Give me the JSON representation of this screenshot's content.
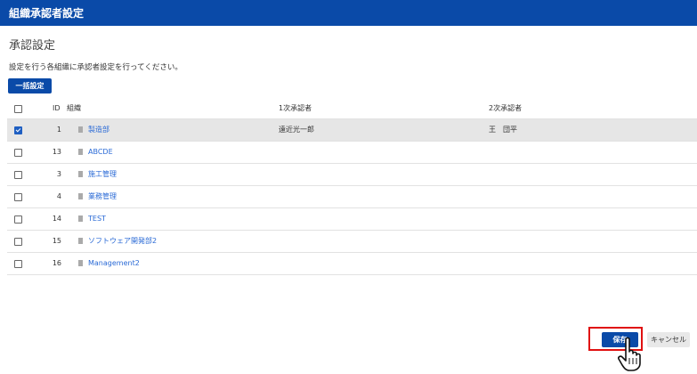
{
  "header": {
    "title": "組織承認者設定"
  },
  "section": {
    "title": "承認設定",
    "description": "設定を行う各組織に承認者設定を行ってください。",
    "bulk_button": "一括設定"
  },
  "table": {
    "columns": {
      "id": "ID",
      "org": "組織",
      "approver1": "1次承認者",
      "approver2": "2次承認者"
    },
    "rows": [
      {
        "id": "1",
        "org": "製造部",
        "approver1": "遠近光一郎",
        "approver2": "王　団平",
        "checked": true
      },
      {
        "id": "13",
        "org": "ABCDE",
        "approver1": "",
        "approver2": "",
        "checked": false
      },
      {
        "id": "3",
        "org": "施工管理",
        "approver1": "",
        "approver2": "",
        "checked": false
      },
      {
        "id": "4",
        "org": "業務管理",
        "approver1": "",
        "approver2": "",
        "checked": false
      },
      {
        "id": "14",
        "org": "TEST",
        "approver1": "",
        "approver2": "",
        "checked": false
      },
      {
        "id": "15",
        "org": "ソフトウェア開発部2",
        "approver1": "",
        "approver2": "",
        "checked": false
      },
      {
        "id": "16",
        "org": "Management2",
        "approver1": "",
        "approver2": "",
        "checked": false
      }
    ]
  },
  "footer": {
    "save_label": "保存",
    "cancel_label": "キャンセル"
  },
  "icons": {
    "row_icon": "document-icon",
    "cursor": "hand-pointer-icon"
  },
  "colors": {
    "primary": "#0a4aa8",
    "link": "#2a6ad6",
    "highlight": "#e01010",
    "selected_row": "#e6e6e6"
  }
}
